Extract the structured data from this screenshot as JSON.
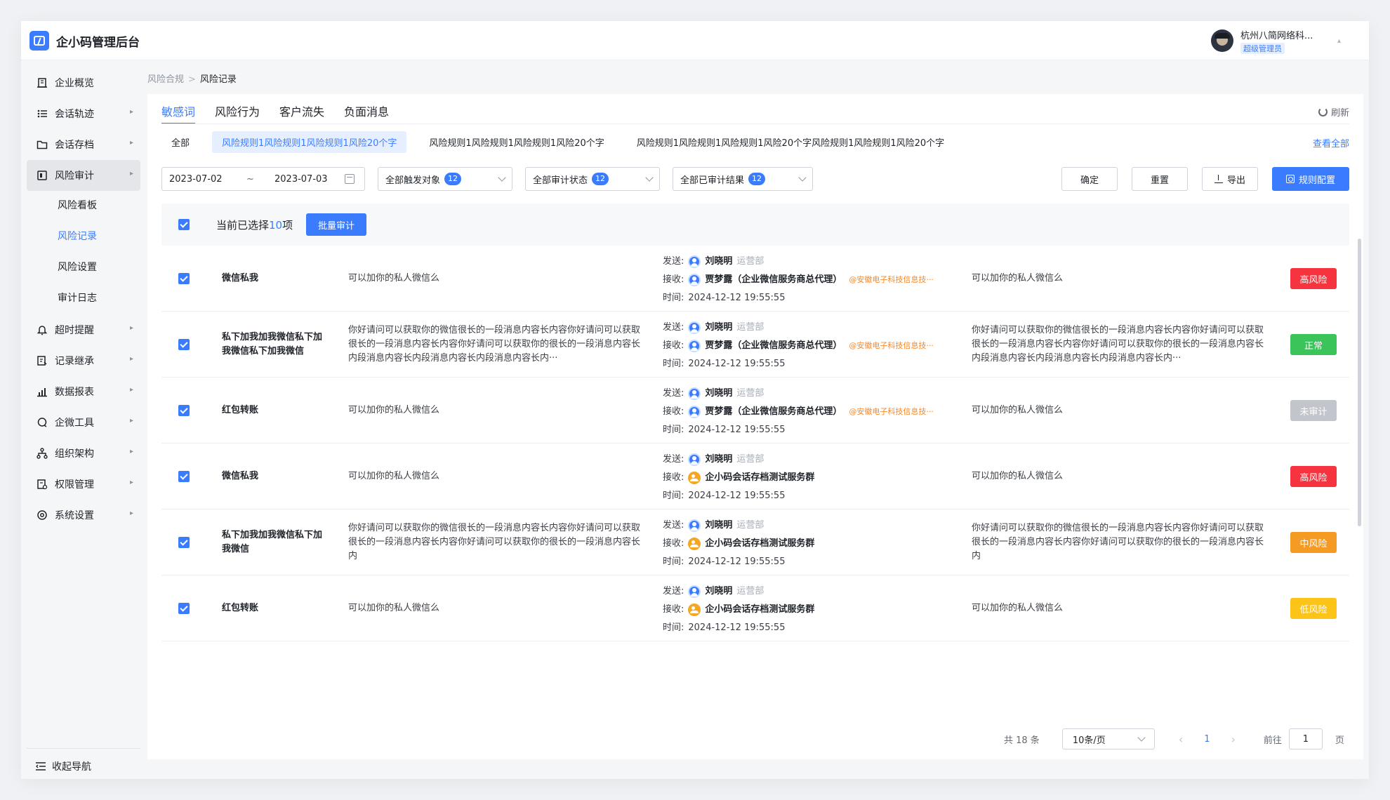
{
  "app": {
    "title": "企小码管理后台"
  },
  "user": {
    "name": "杭州八简网络科...",
    "role": "超级管理员"
  },
  "sidebar": {
    "items": [
      {
        "label": "企业概览"
      },
      {
        "label": "会话轨迹"
      },
      {
        "label": "会话存档"
      },
      {
        "label": "风险审计"
      },
      {
        "label": "超时提醒"
      },
      {
        "label": "记录继承"
      },
      {
        "label": "数据报表"
      },
      {
        "label": "企微工具"
      },
      {
        "label": "组织架构"
      },
      {
        "label": "权限管理"
      },
      {
        "label": "系统设置"
      }
    ],
    "sub_items": [
      {
        "label": "风险看板"
      },
      {
        "label": "风险记录"
      },
      {
        "label": "风险设置"
      },
      {
        "label": "审计日志"
      }
    ],
    "collapse": "收起导航"
  },
  "breadcrumb": {
    "parent": "风险合规",
    "sep": ">",
    "current": "风险记录"
  },
  "tabs": [
    {
      "label": "敏感词"
    },
    {
      "label": "风险行为"
    },
    {
      "label": "客户流失"
    },
    {
      "label": "负面消息"
    }
  ],
  "refresh": "刷新",
  "rules": [
    {
      "label": "全部"
    },
    {
      "label": "风险规则1风险规则1风险规则1风险20个字"
    },
    {
      "label": "风险规则1风险规则1风险规则1风险20个字"
    },
    {
      "label": "风险规则1风险规则1风险规则1风险20个字风险规则1风险规则1风险20个字"
    }
  ],
  "view_all": "查看全部",
  "filters": {
    "date_start": "2023-07-02",
    "date_sep": "~",
    "date_end": "2023-07-03",
    "trigger": {
      "label": "全部触发对象",
      "count": "12"
    },
    "audit_status": {
      "label": "全部审计状态",
      "count": "12"
    },
    "audit_result": {
      "label": "全部已审计结果",
      "count": "12"
    },
    "confirm": "确定",
    "reset": "重置",
    "export": "导出",
    "rule_config": "规则配置"
  },
  "selection": {
    "prefix": "当前已选择",
    "count": "10",
    "suffix": "项",
    "batch": "批量审计"
  },
  "labels": {
    "send": "发送:",
    "receive": "接收:",
    "time": "时间:"
  },
  "rows": [
    {
      "keyword": "微信私我",
      "message": "可以加你的私人微信么",
      "sender": "刘晓明",
      "dept": "运营部",
      "receiver": "贾梦露（企业微信服务商总代理）",
      "receiver_type": "person",
      "corp": "@安徽电子科技信息技···",
      "time": "2024-12-12 19:55:55",
      "result": "可以加你的私人微信么",
      "tag": "高风险",
      "tag_color": "#f5343f"
    },
    {
      "keyword": "私下加我加我微信私下加我微信私下加我微信",
      "message": "你好请问可以获取你的微信很长的一段消息内容长内容你好请问可以获取很长的一段消息内容长内容你好请问可以获取你的很长的一段消息内容长内段消息内容长内段消息内容长内段消息内容长内···",
      "sender": "刘晓明",
      "dept": "运营部",
      "receiver": "贾梦露（企业微信服务商总代理）",
      "receiver_type": "person",
      "corp": "@安徽电子科技信息技···",
      "time": "2024-12-12 19:55:55",
      "result": "你好请问可以获取你的微信很长的一段消息内容长内容你好请问可以获取很长的一段消息内容长内容你好请问可以获取你的很长的一段消息内容长内段消息内容长内段消息内容长内段消息内容长内···",
      "tag": "正常",
      "tag_color": "#3bc45a"
    },
    {
      "keyword": "红包转账",
      "message": "可以加你的私人微信么",
      "sender": "刘晓明",
      "dept": "运营部",
      "receiver": "贾梦露（企业微信服务商总代理）",
      "receiver_type": "person",
      "corp": "@安徽电子科技信息技···",
      "time": "2024-12-12 19:55:55",
      "result": "可以加你的私人微信么",
      "tag": "未审计",
      "tag_color": "#c2c6cc"
    },
    {
      "keyword": "微信私我",
      "message": "可以加你的私人微信么",
      "sender": "刘晓明",
      "dept": "运营部",
      "receiver": "企小码会话存档测试服务群",
      "receiver_type": "group",
      "corp": "",
      "time": "2024-12-12 19:55:55",
      "result": "可以加你的私人微信么",
      "tag": "高风险",
      "tag_color": "#f5343f"
    },
    {
      "keyword": "私下加我加我微信私下加我微信",
      "message": "你好请问可以获取你的微信很长的一段消息内容长内容你好请问可以获取很长的一段消息内容长内容你好请问可以获取你的很长的一段消息内容长内",
      "sender": "刘晓明",
      "dept": "运营部",
      "receiver": "企小码会话存档测试服务群",
      "receiver_type": "group",
      "corp": "",
      "time": "2024-12-12 19:55:55",
      "result": "你好请问可以获取你的微信很长的一段消息内容长内容你好请问可以获取很长的一段消息内容长内容你好请问可以获取你的很长的一段消息内容长内",
      "tag": "中风险",
      "tag_color": "#f59a23"
    },
    {
      "keyword": "红包转账",
      "message": "可以加你的私人微信么",
      "sender": "刘晓明",
      "dept": "运营部",
      "receiver": "企小码会话存档测试服务群",
      "receiver_type": "group",
      "corp": "",
      "time": "2024-12-12 19:55:55",
      "result": "可以加你的私人微信么",
      "tag": "低风险",
      "tag_color": "#fcc419"
    }
  ],
  "pagination": {
    "total": "共 18 条",
    "page_size": "10条/页",
    "prev": "‹",
    "current": "1",
    "next": "›",
    "goto": "前往",
    "goto_value": "1",
    "page_unit": "页"
  }
}
